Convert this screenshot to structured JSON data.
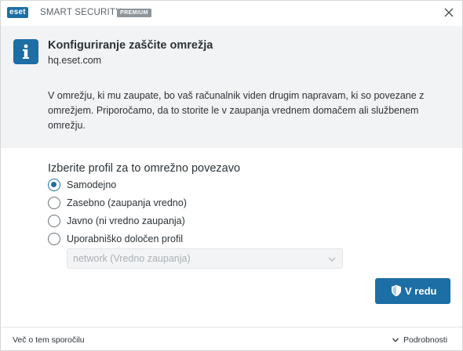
{
  "titlebar": {
    "logo": "eset",
    "product": "SMART SECURITY",
    "tier": "PREMIUM"
  },
  "info": {
    "heading": "Konfiguriranje zaščite omrežja",
    "host": "hq.eset.com",
    "description": "V omrežju, ki mu zaupate, bo vaš računalnik viden drugim napravam, ki so povezane z omrežjem. Priporočamo, da to storite le v zaupanja vrednem domačem ali službenem omrežju."
  },
  "profile": {
    "title": "Izberite profil za to omrežno povezavo",
    "options": [
      {
        "label": "Samodejno",
        "selected": true
      },
      {
        "label": "Zasebno (zaupanja vredno)",
        "selected": false
      },
      {
        "label": "Javno (ni vredno zaupanja)",
        "selected": false
      },
      {
        "label": "Uporabniško določen profil",
        "selected": false
      }
    ],
    "custom_select_value": "network (Vredno zaupanja)"
  },
  "actions": {
    "ok_label": "V redu"
  },
  "footer": {
    "more_link": "Več o tem sporočilu",
    "details_label": "Podrobnosti"
  },
  "colors": {
    "accent": "#1d6ea5",
    "panel_bg": "#f2f3f4"
  },
  "icons": {
    "logo": "eset-logo",
    "close": "close-icon",
    "info": "info-icon",
    "chevron": "chevron-down-icon",
    "shield": "shield-icon"
  }
}
